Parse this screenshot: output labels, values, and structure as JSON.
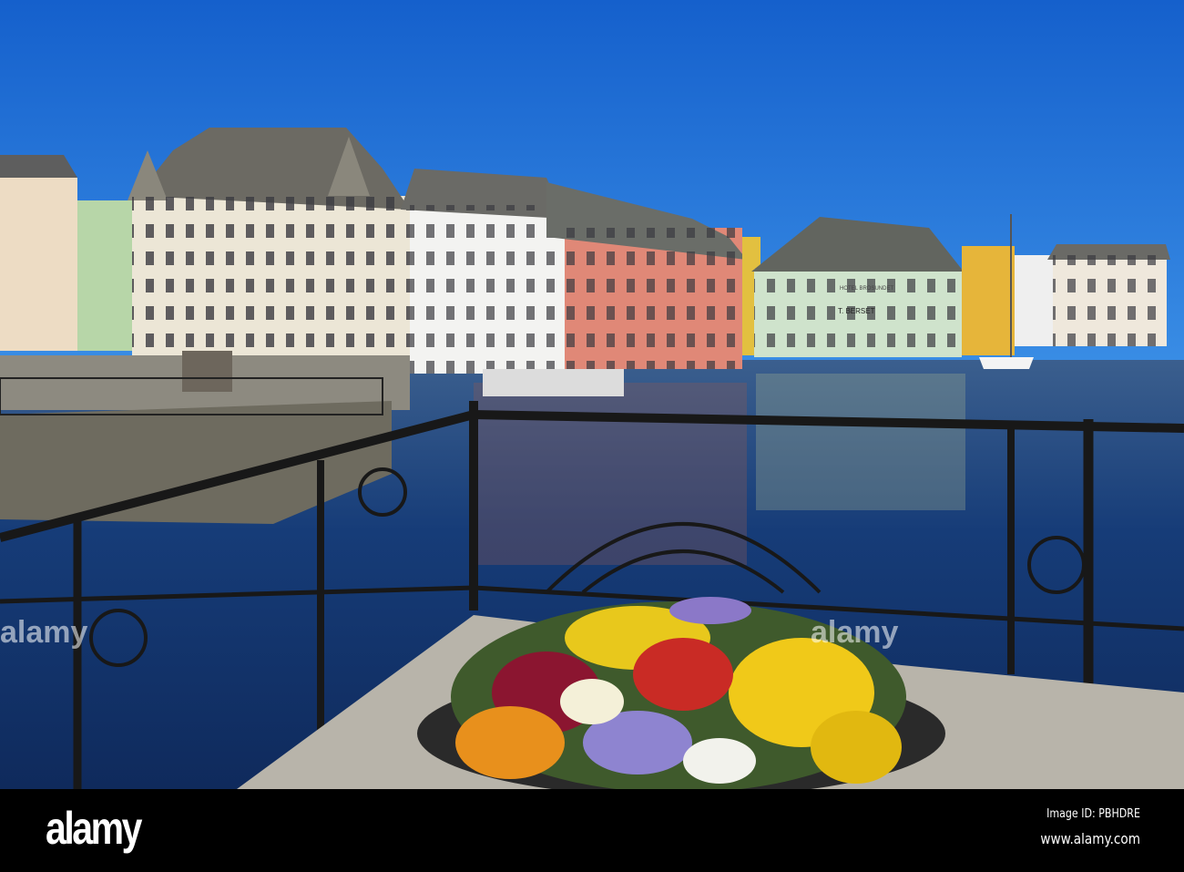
{
  "photo": {
    "signs": {
      "hotel": "HOTEL BROSUNDET",
      "owner": "T. BERSET"
    },
    "watermark": "alamy"
  },
  "footer": {
    "logo": "alamy",
    "image_id": "Image ID: PBHDRE",
    "url": "www.alamy.com"
  },
  "colors": {
    "sky": "#1f6ed4",
    "water": "#173a72",
    "railing": "#1a1a1a"
  }
}
